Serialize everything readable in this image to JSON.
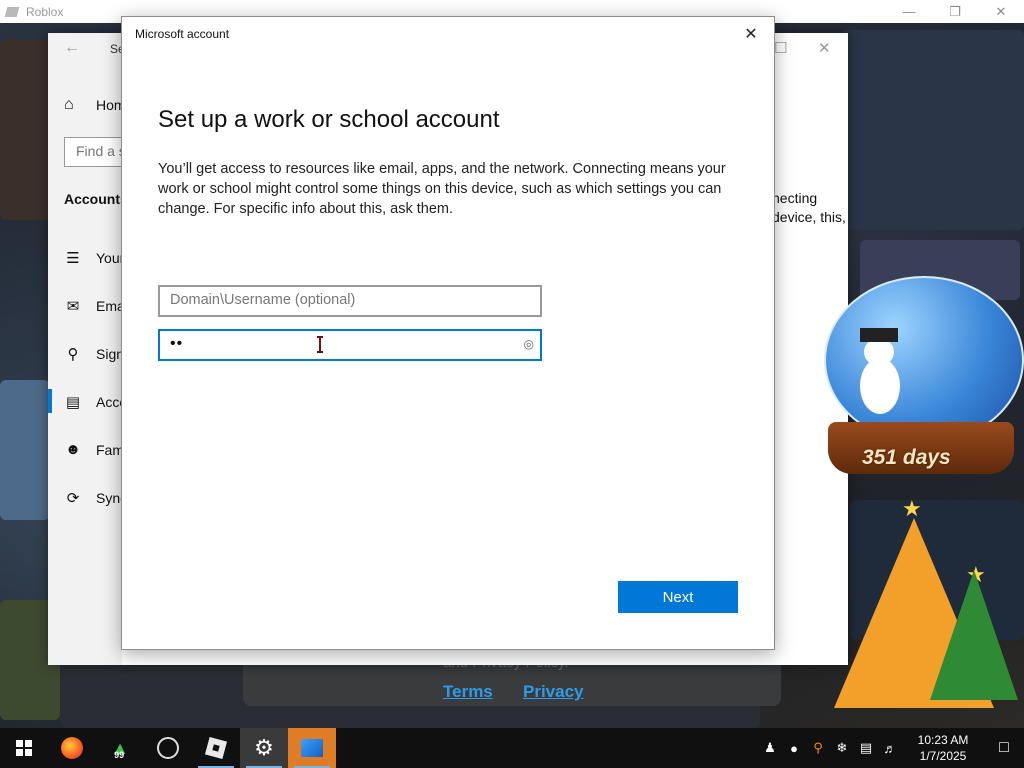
{
  "roblox": {
    "window_title": "Roblox",
    "footer_faded": "and Privacy Policy.",
    "terms_link": "Terms",
    "privacy_link": "Privacy"
  },
  "settings": {
    "title": "Se",
    "home": "Hom",
    "search_placeholder": "Find a s",
    "section": "Accounts",
    "items": [
      {
        "label": "Your",
        "icon": "user-info-icon"
      },
      {
        "label": "Ema",
        "icon": "mail-icon"
      },
      {
        "label": "Sign",
        "icon": "key-icon"
      },
      {
        "label": "Acce",
        "icon": "briefcase-icon"
      },
      {
        "label": "Fam",
        "icon": "family-icon"
      },
      {
        "label": "Sync",
        "icon": "sync-icon"
      }
    ],
    "body_text": "necting device, this,"
  },
  "dialog": {
    "title": "Microsoft account",
    "heading": "Set up a work or school account",
    "description": "You’ll get access to resources like email, apps, and the network. Connecting means your work or school might control some things on this device, such as which settings you can change. For specific info about this, ask them.",
    "username_placeholder": "Domain\\Username (optional)",
    "password_value": "••",
    "next_label": "Next"
  },
  "decoration": {
    "globe_label": "351 days"
  },
  "taskbar": {
    "time": "10:23 AM",
    "date": "1/7/2025",
    "tree_badge": "99"
  },
  "colors": {
    "accent": "#0078d7",
    "link": "#2f9be8",
    "taskbar": "#101010"
  }
}
